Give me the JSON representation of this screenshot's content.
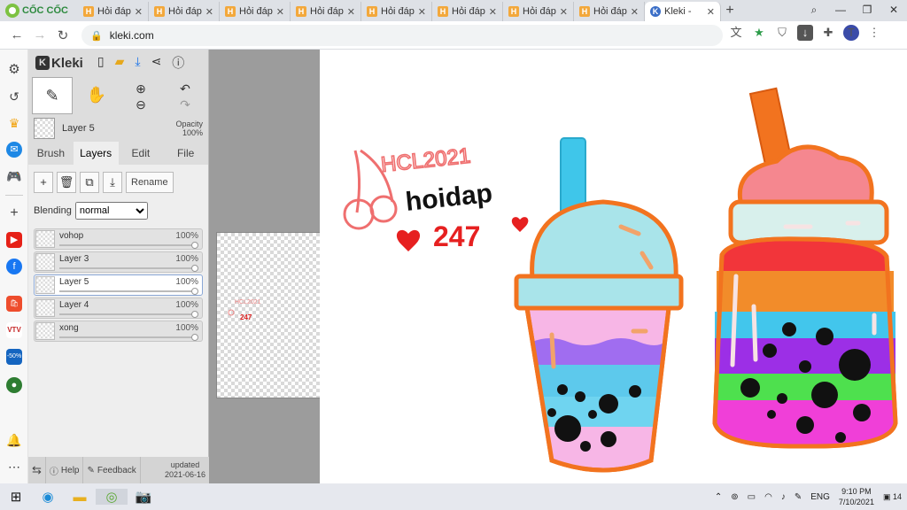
{
  "browser": {
    "brand": "CỐC CỐC",
    "tabs": [
      {
        "title": "Hỏi đáp",
        "icon": "H"
      },
      {
        "title": "Hỏi đáp",
        "icon": "H"
      },
      {
        "title": "Hỏi đáp",
        "icon": "H"
      },
      {
        "title": "Hỏi đáp",
        "icon": "H"
      },
      {
        "title": "Hỏi đáp",
        "icon": "H"
      },
      {
        "title": "Hỏi đáp",
        "icon": "H"
      },
      {
        "title": "Hỏi đáp",
        "icon": "H"
      },
      {
        "title": "Hỏi đáp",
        "icon": "H"
      },
      {
        "title": "Kleki -",
        "icon": "K",
        "active": true
      }
    ],
    "url": "kleki.com",
    "profile_initial": "T"
  },
  "kleki": {
    "app_name": "Kleki",
    "current_layer": "Layer 5",
    "opacity_label": "Opacity",
    "opacity_value": "100%",
    "tabs": [
      "Brush",
      "Layers",
      "Edit",
      "File"
    ],
    "active_tab": "Layers",
    "rename_label": "Rename",
    "blending_label": "Blending",
    "blending_value": "normal",
    "layers": [
      {
        "name": "vohop",
        "opacity": "100%"
      },
      {
        "name": "Layer 3",
        "opacity": "100%"
      },
      {
        "name": "Layer 5",
        "opacity": "100%",
        "selected": true
      },
      {
        "name": "Layer 4",
        "opacity": "100%"
      },
      {
        "name": "xong",
        "opacity": "100%"
      }
    ],
    "footer": {
      "help": "Help",
      "feedback": "Feedback",
      "updated_label": "updated",
      "updated_date": "2021-06-16"
    }
  },
  "drawing": {
    "line1": "HCL2021",
    "line2": "hoidap",
    "line3": "247"
  },
  "taskbar": {
    "lang": "ENG",
    "time": "9:10 PM",
    "date": "7/10/2021",
    "notifications": "14"
  },
  "colors": {
    "canvas_bg": "#ffffff",
    "stage_bg": "#9c9c9c",
    "panel_bg": "#dddddd",
    "accent": "#1a73e8"
  }
}
